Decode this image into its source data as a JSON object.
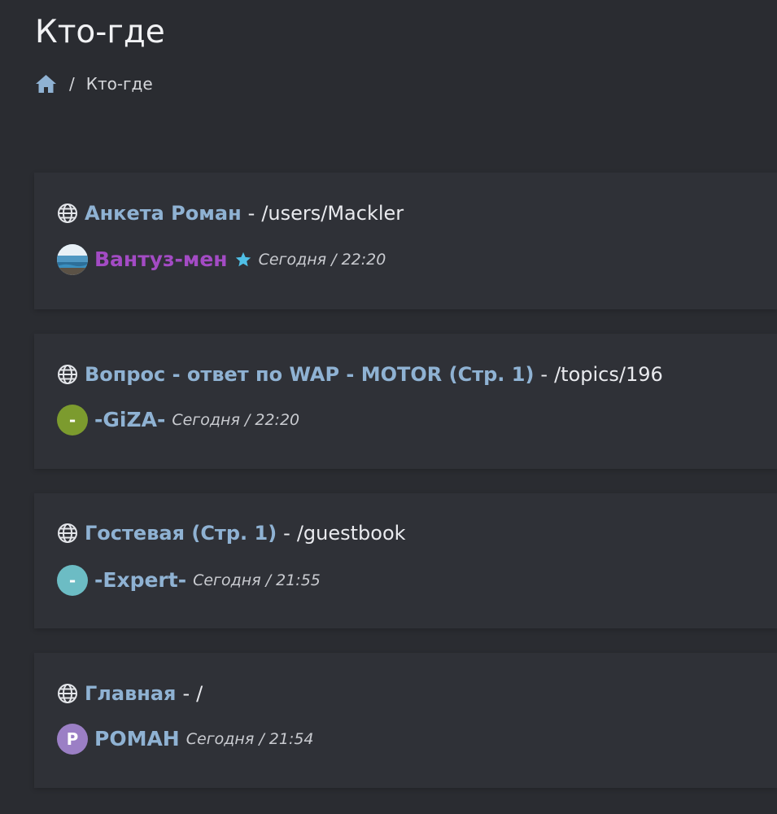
{
  "header": {
    "title": "Кто-где",
    "breadcrumb": {
      "home_icon": "home-icon",
      "separator": "/",
      "current": "Кто-где"
    }
  },
  "colors": {
    "background": "#2a2c31",
    "card": "#2f3137",
    "link": "#8fb2d3",
    "admin_name": "#a34bc4",
    "star": "#4fbfe6"
  },
  "entries": [
    {
      "page_title": "Анкета Роман",
      "separator": "-",
      "path": "/users/Mackler",
      "user": {
        "name": "Вантуз-мен",
        "avatar_type": "photo",
        "name_color": "#a34bc4",
        "badge_icon": "star-icon"
      },
      "time": "Сегодня / 22:20"
    },
    {
      "page_title": "Вопрос - ответ по WAP - MOTOR (Стр. 1)",
      "separator": "-",
      "path": "/topics/196",
      "user": {
        "name": "-GiZA-",
        "avatar_letter": "-",
        "avatar_color": "#7c9b2e",
        "name_color": "#8fb2d3"
      },
      "time": "Сегодня / 22:20"
    },
    {
      "page_title": "Гостевая (Стр. 1)",
      "separator": "-",
      "path": "/guestbook",
      "user": {
        "name": "-Expert-",
        "avatar_letter": "-",
        "avatar_color": "#6cbcc4",
        "name_color": "#8fb2d3"
      },
      "time": "Сегодня / 21:55"
    },
    {
      "page_title": "Главная",
      "separator": "-",
      "path": "/",
      "user": {
        "name": "РОМАН",
        "avatar_letter": "Р",
        "avatar_color": "#9b7fc5",
        "name_color": "#8fb2d3"
      },
      "time": "Сегодня / 21:54"
    }
  ]
}
